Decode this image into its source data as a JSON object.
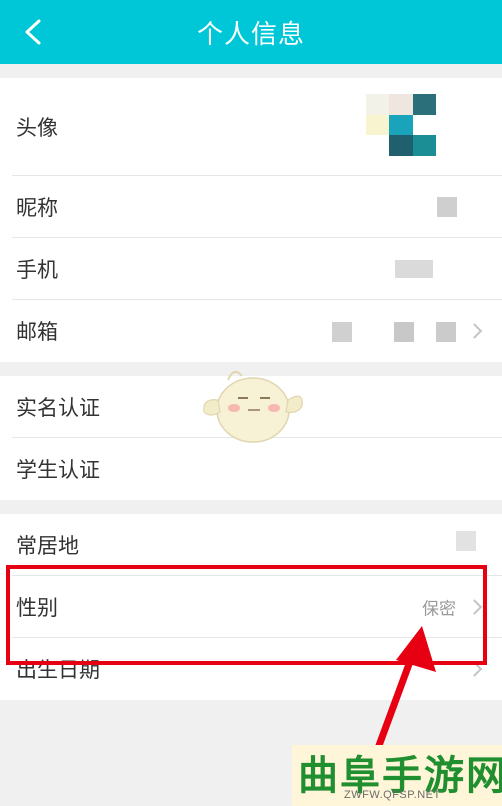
{
  "header": {
    "title": "个人信息"
  },
  "section1": [
    {
      "label": "头像"
    },
    {
      "label": "昵称"
    },
    {
      "label": "手机"
    },
    {
      "label": "邮箱"
    }
  ],
  "section2": [
    {
      "label": "实名认证"
    },
    {
      "label": "学生认证"
    }
  ],
  "section3": [
    {
      "label": "常居地"
    },
    {
      "label": "性别",
      "value": "保密"
    },
    {
      "label": "出生日期"
    }
  ],
  "watermark": {
    "main": "曲阜手游网",
    "sub": "ZWFW.QFSP.NET"
  },
  "colors": {
    "header": "#00c7d8",
    "annotation": "#e60012",
    "watermark_green": "#1f8f2f"
  }
}
